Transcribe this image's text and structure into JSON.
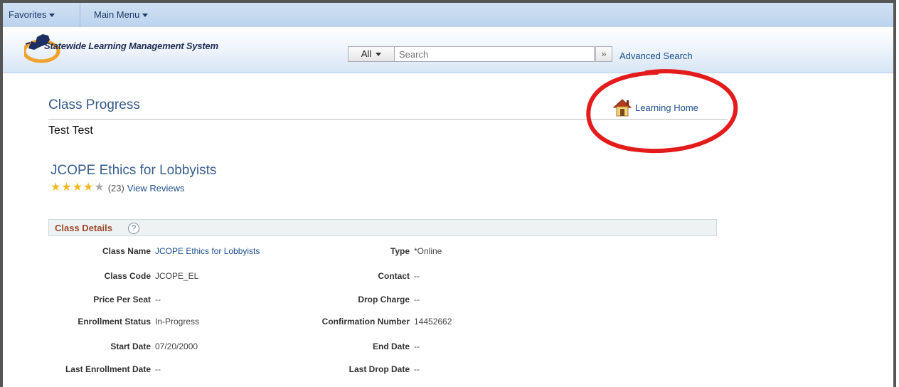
{
  "nav": {
    "favorites": "Favorites",
    "main_menu": "Main Menu"
  },
  "header": {
    "app_title": "Statewide Learning Management System",
    "scope": "All",
    "search_placeholder": "Search",
    "search_go": "»",
    "advanced_search": "Advanced Search"
  },
  "page": {
    "title": "Class Progress",
    "learning_home": "Learning Home",
    "user": "Test Test"
  },
  "course": {
    "title": "JCOPE Ethics for Lobbyists",
    "rating": 4,
    "rating_max": 5,
    "review_count": "(23)",
    "view_reviews": "View Reviews"
  },
  "details": {
    "section_title": "Class Details",
    "help": "?",
    "left": [
      {
        "label": "Class Name",
        "value": "JCOPE Ethics for Lobbyists",
        "link": true
      },
      {
        "label": "Class Code",
        "value": "JCOPE_EL"
      },
      {
        "label": "Price Per Seat",
        "value": "--"
      },
      {
        "label": "Enrollment Status",
        "value": "In-Progress"
      },
      {
        "label": "Start Date",
        "value": "07/20/2000"
      },
      {
        "label": "Last Enrollment Date",
        "value": "--"
      }
    ],
    "right": [
      {
        "label": "Type",
        "value": "*Online"
      },
      {
        "label": "Contact",
        "value": "--"
      },
      {
        "label": "Drop Charge",
        "value": "--"
      },
      {
        "label": "Confirmation Number",
        "value": "14452662"
      },
      {
        "label": "End Date",
        "value": "--"
      },
      {
        "label": "Last Drop Date",
        "value": "--"
      }
    ]
  },
  "colors": {
    "annotation_circle": "#e31b1b",
    "link": "#1b4f8f",
    "section_title": "#9b4a2a"
  }
}
